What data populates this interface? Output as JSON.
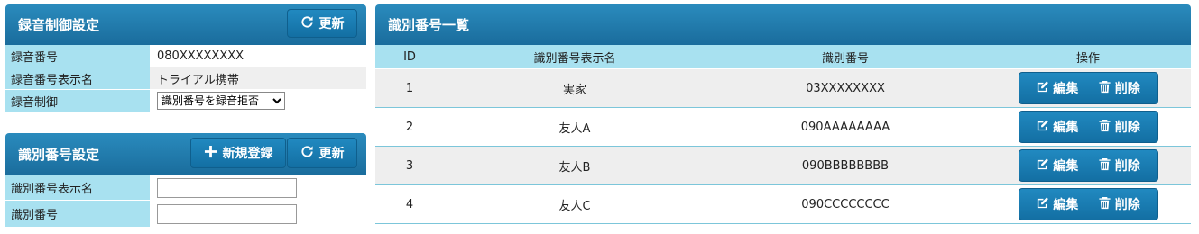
{
  "record_panel": {
    "title": "録音制御設定",
    "refresh_label": "更新",
    "rows": [
      {
        "label": "録音番号",
        "value": "080XXXXXXXX"
      },
      {
        "label": "録音番号表示名",
        "value": "トライアル携帯"
      },
      {
        "label": "録音制御",
        "value": "識別番号を録音拒否"
      }
    ]
  },
  "id_settings_panel": {
    "title": "識別番号設定",
    "new_label": "新規登録",
    "refresh_label": "更新",
    "fields": [
      {
        "label": "識別番号表示名",
        "value": ""
      },
      {
        "label": "識別番号",
        "value": ""
      }
    ]
  },
  "id_list_panel": {
    "title": "識別番号一覧",
    "columns": [
      "ID",
      "識別番号表示名",
      "識別番号",
      "操作"
    ],
    "edit_label": "編集",
    "delete_label": "削除",
    "rows": [
      {
        "id": "1",
        "name": "実家",
        "number": "03XXXXXXXX"
      },
      {
        "id": "2",
        "name": "友人A",
        "number": "090AAAAAAAA"
      },
      {
        "id": "3",
        "name": "友人B",
        "number": "090BBBBBBBB"
      },
      {
        "id": "4",
        "name": "友人C",
        "number": "090CCCCCCCC"
      }
    ]
  },
  "icons": {
    "refresh": "refresh-icon",
    "plus": "plus-icon",
    "edit": "edit-icon",
    "delete": "trash-icon"
  }
}
